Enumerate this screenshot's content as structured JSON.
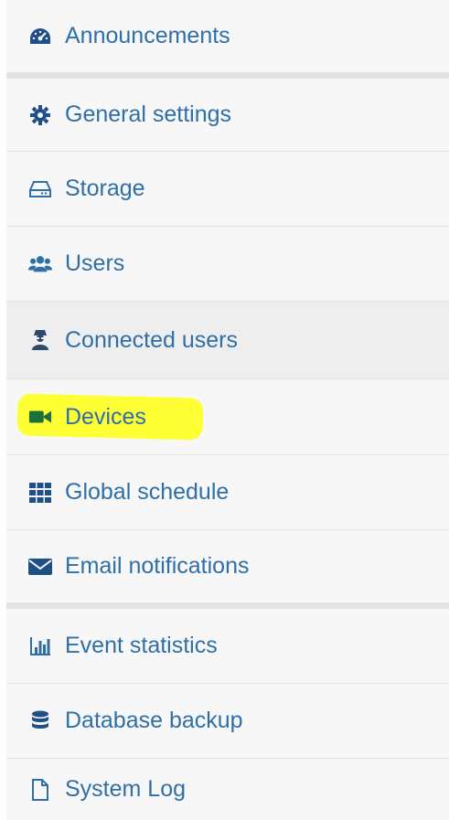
{
  "menu": {
    "items": [
      {
        "label": "Announcements",
        "icon": "dashboard-gauge-icon"
      },
      {
        "label": "General settings",
        "icon": "gear-icon"
      },
      {
        "label": "Storage",
        "icon": "hard-drive-icon"
      },
      {
        "label": "Users",
        "icon": "users-group-icon"
      },
      {
        "label": "Connected users",
        "icon": "user-secret-icon",
        "state": "selected"
      },
      {
        "label": "Devices",
        "icon": "video-camera-icon",
        "annotation": "yellow-highlight"
      },
      {
        "label": "Global schedule",
        "icon": "grid-icon"
      },
      {
        "label": "Email notifications",
        "icon": "envelope-icon"
      },
      {
        "label": "Event statistics",
        "icon": "bar-chart-icon"
      },
      {
        "label": "Database backup",
        "icon": "database-icon"
      },
      {
        "label": "System Log",
        "icon": "file-icon"
      }
    ]
  },
  "colors": {
    "link": "#2f6fa8",
    "icon": "#1f4f87",
    "devices_icon": "#1f6f3a",
    "highlight": "#ffff2a",
    "selected_bg": "#eeeeee",
    "menu_bg": "#f7f7f7",
    "separator": "#e3e3e3"
  }
}
